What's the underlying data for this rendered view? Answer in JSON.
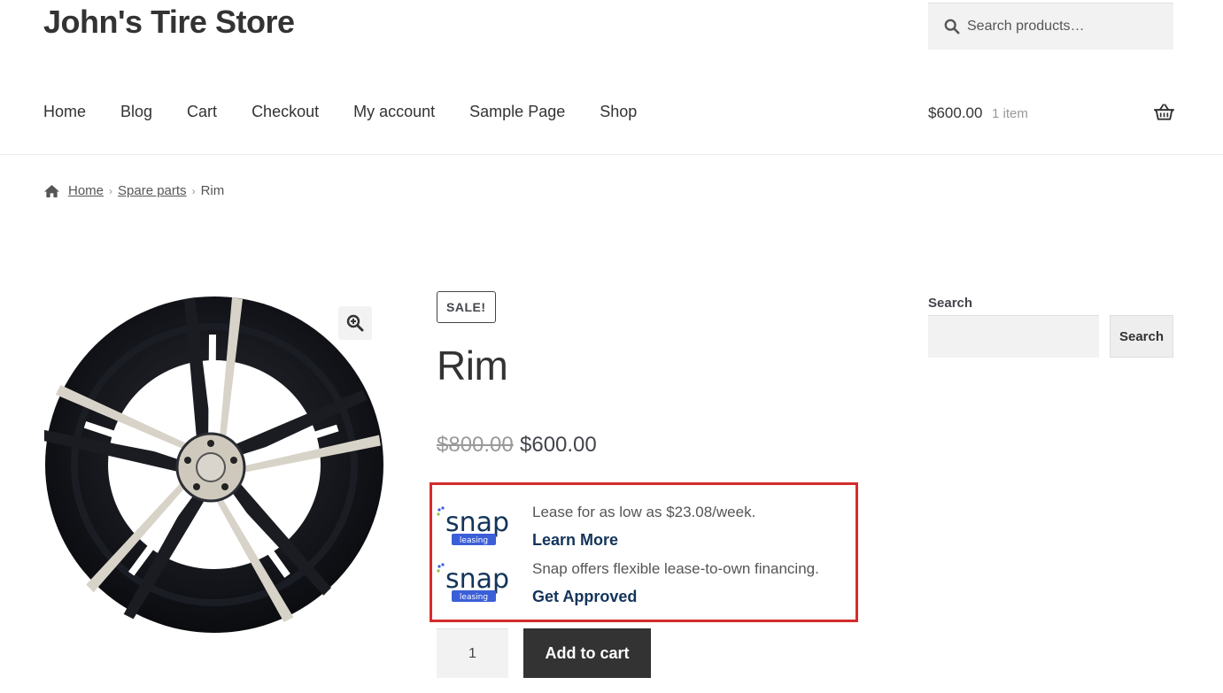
{
  "site": {
    "title": "John's Tire Store"
  },
  "header_search": {
    "placeholder": "Search products…",
    "icon": "search-icon"
  },
  "nav": {
    "items": [
      {
        "label": "Home"
      },
      {
        "label": "Blog"
      },
      {
        "label": "Cart"
      },
      {
        "label": "Checkout"
      },
      {
        "label": "My account"
      },
      {
        "label": "Sample Page"
      },
      {
        "label": "Shop"
      }
    ]
  },
  "cart": {
    "total": "$600.00",
    "count": "1 item",
    "icon": "basket-icon"
  },
  "breadcrumb": {
    "home": "Home",
    "category": "Spare parts",
    "current": "Rim",
    "separator": "›"
  },
  "product": {
    "badge": "SALE!",
    "title": "Rim",
    "regular_price": "$800.00",
    "sale_price": "$600.00",
    "image_icon": "wheel-rim-image",
    "zoom_icon": "zoom-in-icon"
  },
  "snap": {
    "logo_text": "snap",
    "logo_subtext": "leasing",
    "offers": [
      {
        "text": "Lease for as low as $23.08/week.",
        "link": "Learn More"
      },
      {
        "text": "Snap offers flexible lease-to-own financing.",
        "link": "Get Approved"
      }
    ],
    "colors": {
      "brand_blue": "#13345a",
      "brand_accent": "#3b5fd8",
      "highlight_border": "#d52b2b"
    }
  },
  "purchase": {
    "quantity": "1",
    "button_label": "Add to cart"
  },
  "sidebar": {
    "search_heading": "Search",
    "search_button": "Search"
  },
  "colors": {
    "text_dark": "#333333",
    "text_body": "#43454b",
    "muted": "#999999",
    "input_bg": "#f2f2f2",
    "button_dark": "#333333"
  }
}
